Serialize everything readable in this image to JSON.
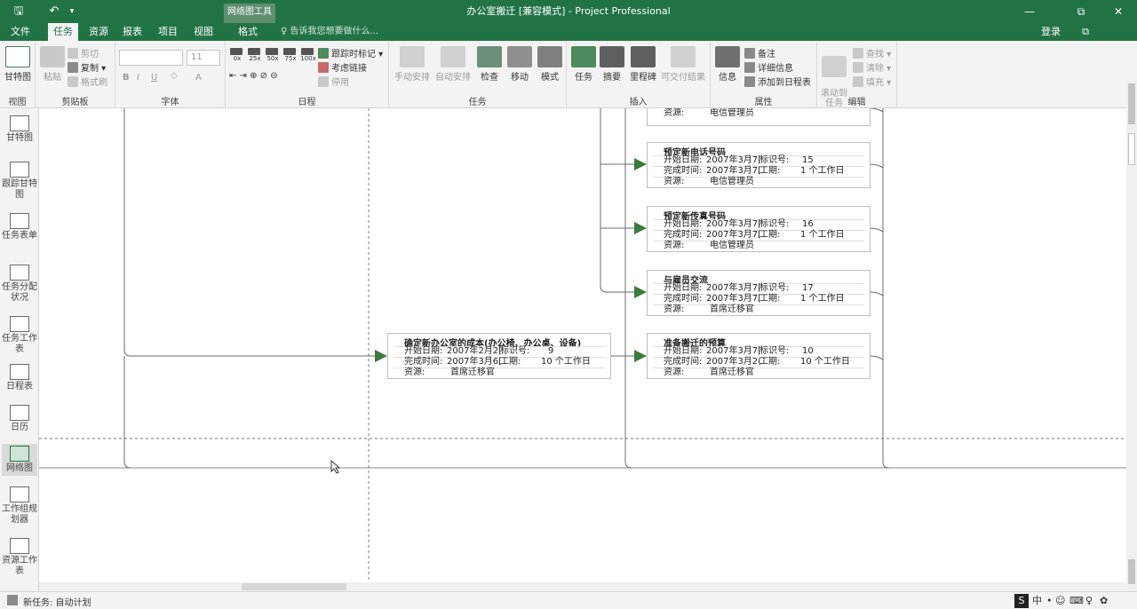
{
  "window": {
    "doc_title": "办公室搬迁 [兼容模式] - Project Professional",
    "context_tab": "网络图工具",
    "min_icon": "minimize-icon",
    "restore_icon": "restore-icon",
    "close_icon": "close-icon",
    "window_controls": [
      "—",
      "⧉",
      "✕"
    ],
    "accent": "#217346"
  },
  "quick_access": {
    "save_icon": "save-icon",
    "undo_icon": "undo-icon",
    "glyphs": [
      "🖫",
      "↶",
      "▾"
    ]
  },
  "tabs": [
    {
      "label": "文件"
    },
    {
      "label": "任务"
    },
    {
      "label": "资源"
    },
    {
      "label": "报表"
    },
    {
      "label": "项目"
    },
    {
      "label": "视图"
    },
    {
      "label": "格式"
    }
  ],
  "tell_me": "♀ 告诉我您想要做什么...",
  "login": "登录",
  "ribbon": {
    "view": {
      "gantt": "甘特图",
      "label": "视图"
    },
    "clipboard": {
      "paste": "粘贴",
      "cut": "剪切",
      "copy": "复制 ▾",
      "format_painter": "格式刷",
      "label": "剪贴板"
    },
    "font": {
      "size": "11",
      "bold": "B",
      "italic": "I",
      "underline": "U",
      "font_color": "A",
      "label": "字体"
    },
    "schedule": {
      "pct": [
        "0x",
        "25x",
        "50x",
        "75x",
        "100x"
      ],
      "mark_track": "跟踪时标记 ▾",
      "respect_links": "考虑链接",
      "inactivate": "停用",
      "label": "日程"
    },
    "tasks": {
      "manual": "手动安排",
      "auto": "自动安排",
      "inspect": "检查",
      "move": "移动",
      "mode": "模式",
      "label": "任务"
    },
    "insert": {
      "task": "任务",
      "summary": "摘要",
      "milestone": "里程碑",
      "deliverable": "可交付结果",
      "label": "插入"
    },
    "properties": {
      "info": "信息",
      "notes": "备注",
      "details": "详细信息",
      "add_timeline": "添加到日程表",
      "label": "属性"
    },
    "editing": {
      "scroll_to": "滚动到\n任务",
      "find": "查找 ▾",
      "clear": "清除 ▾",
      "fill": "填充 ▾",
      "label": "编辑"
    }
  },
  "view_bar": [
    {
      "label": "甘特图",
      "active": false
    },
    {
      "label": "跟踪甘特图",
      "active": false
    },
    {
      "label": "任务表单",
      "active": false
    },
    {
      "label": "任务分配状况",
      "active": false
    },
    {
      "label": "任务工作表",
      "active": false
    },
    {
      "label": "日程表",
      "active": false
    },
    {
      "label": "日历",
      "active": false
    },
    {
      "label": "网络图",
      "active": true
    },
    {
      "label": "工作组规划器",
      "active": false
    },
    {
      "label": "资源工作表",
      "active": false
    }
  ],
  "network": {
    "line_color": "#6b6b6b",
    "arrow_color": "#3e7a3e",
    "top_partial": {
      "resource_label": "资源:",
      "resource": "电信管理员"
    },
    "tasks": [
      {
        "name": "预定新电话号码",
        "start_label": "开始日期:",
        "start": "2007年3月7[",
        "id_label": "标识号:",
        "id": "15",
        "finish_label": "完成时间:",
        "finish": "2007年3月7[",
        "dur_label": "工期:",
        "duration": "1 个工作日",
        "res_label": "资源:",
        "resource": "电信管理员"
      },
      {
        "name": "预定新传真号码",
        "start_label": "开始日期:",
        "start": "2007年3月7[",
        "id_label": "标识号:",
        "id": "16",
        "finish_label": "完成时间:",
        "finish": "2007年3月7[",
        "dur_label": "工期:",
        "duration": "1 个工作日",
        "res_label": "资源:",
        "resource": "电信管理员"
      },
      {
        "name": "与雇员交流",
        "start_label": "开始日期:",
        "start": "2007年3月7[",
        "id_label": "标识号:",
        "id": "17",
        "finish_label": "完成时间:",
        "finish": "2007年3月7[",
        "dur_label": "工期:",
        "duration": "1 个工作日",
        "res_label": "资源:",
        "resource": "首席迁移官"
      },
      {
        "name": "准备搬迁的预算",
        "start_label": "开始日期:",
        "start": "2007年3月7[",
        "id_label": "标识号:",
        "id": "10",
        "finish_label": "完成时间:",
        "finish": "2007年3月2(",
        "dur_label": "工期:",
        "duration": "10 个工作日",
        "res_label": "资源:",
        "resource": "首席迁移官"
      },
      {
        "name": "确定新办公室的成本(办公椅、办公桌、设备)",
        "start_label": "开始日期:",
        "start": "2007年2月2[",
        "id_label": "标识号:",
        "id": "9",
        "finish_label": "完成时间:",
        "finish": "2007年3月6[",
        "dur_label": "工期:",
        "duration": "10 个工作日",
        "res_label": "资源:",
        "resource": "首席迁移官"
      }
    ]
  },
  "status": {
    "text": "新任务: 自动计划"
  },
  "tray": {
    "ime": "中",
    "glyphs": [
      "S",
      "中",
      "•",
      "☺",
      "⌨",
      "♀",
      "✿"
    ]
  }
}
